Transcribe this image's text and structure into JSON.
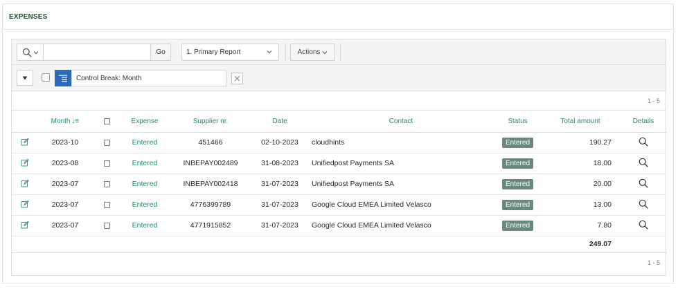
{
  "region": {
    "title": "EXPENSES"
  },
  "toolbar": {
    "search_value": "",
    "go_label": "Go",
    "report_label": "1. Primary Report",
    "actions_label": "Actions"
  },
  "filter": {
    "label": "Control Break: Month"
  },
  "pagination": {
    "top": "1 - 5",
    "bottom": "1 - 5"
  },
  "table": {
    "headers": {
      "month": "Month",
      "expense": "Expense",
      "supplier": "Supplier nr.",
      "date": "Date",
      "contact": "Contact",
      "status": "Status",
      "total": "Total amount",
      "details": "Details"
    },
    "rows": [
      {
        "month": "2023-10",
        "expense": "Entered",
        "supplier": "451466",
        "date": "02-10-2023",
        "contact": "cloudhints",
        "status": "Entered",
        "total": "190.27"
      },
      {
        "month": "2023-08",
        "expense": "Entered",
        "supplier": "INBEPAY002489",
        "date": "31-08-2023",
        "contact": "Unifiedpost Payments SA",
        "status": "Entered",
        "total": "18.00"
      },
      {
        "month": "2023-07",
        "expense": "Entered",
        "supplier": "INBEPAY002418",
        "date": "31-07-2023",
        "contact": "Unifiedpost Payments SA",
        "status": "Entered",
        "total": "20.00"
      },
      {
        "month": "2023-07",
        "expense": "Entered",
        "supplier": "4776399789",
        "date": "31-07-2023",
        "contact": "Google Cloud EMEA Limited Velasco",
        "status": "Entered",
        "total": "13.00"
      },
      {
        "month": "2023-07",
        "expense": "Entered",
        "supplier": "4771915852",
        "date": "31-07-2023",
        "contact": "Google Cloud EMEA Limited Velasco",
        "status": "Entered",
        "total": "7.80"
      }
    ],
    "sum_total": "249.07"
  },
  "icons": {
    "search": "search-icon",
    "edit": "edit-icon",
    "details": "magnifier-icon",
    "control_break": "control-break-icon",
    "remove": "close-icon"
  },
  "colors": {
    "title": "#1d4d2c",
    "link": "#1f8a72",
    "badge": "#658a7d",
    "control_break": "#2a6bb8"
  }
}
